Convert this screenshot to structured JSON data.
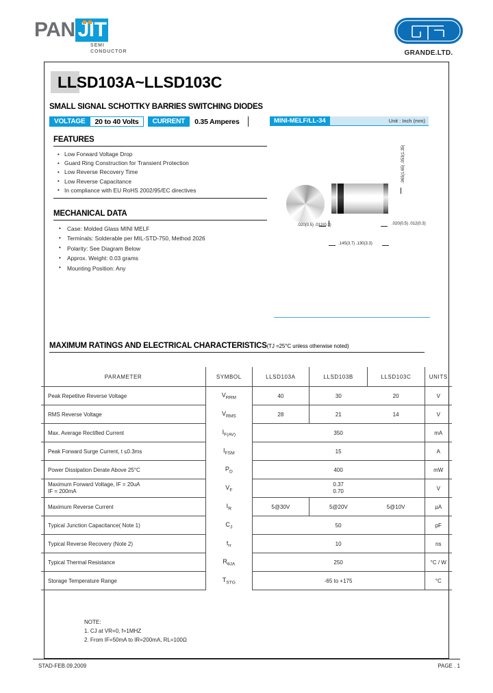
{
  "brand": {
    "panjit_pan": "PAN",
    "panjit_jit": "JIT",
    "panjit_sub_line1": "SEMI",
    "panjit_sub_line2": "CONDUCTOR",
    "grande_name": "GRANDE.LTD.",
    "accent_blue": "#0d9ddb",
    "accent_orange": "#f7941e"
  },
  "header": {
    "part_title": "LLSD103A~LLSD103C",
    "subtitle": "SMALL SIGNAL SCHOTTKY BARRIES SWITCHING DIODES"
  },
  "specbar": {
    "voltage_label": "VOLTAGE",
    "voltage_value": "20 to 40 Volts",
    "current_label": "CURRENT",
    "current_value": "0.35 Amperes",
    "package_name": "MINI-MELF/LL-34",
    "unit_note": "Unit : Inch (mm)"
  },
  "features": {
    "title": "FEATURES",
    "items": [
      "Low Forward Voltage Drop",
      "Guard Ring Construction for Transient Protection",
      "Low Reverse Recovery Time",
      "Low Reverse Capacitance",
      "In compliance with EU RoHS 2002/95/EC directives"
    ]
  },
  "mechanical": {
    "title": "MECHANICAL DATA",
    "items": [
      "Case: Molded Glass MINI MELF",
      "Terminals: Solderable per MIL-STD-750, Method 2026",
      "Polarity: See Diagram Below",
      "Approx. Weight: 0.03 grams",
      "Mounting Position: Any"
    ]
  },
  "package_drawing": {
    "dim_left": ".020(0.5)\n.012(0.3)",
    "dim_right": ".020(0.5)\n.012(0.3)",
    "dim_bottom": ".145(3.7)\n.130(3.3)",
    "dim_height": ".065(1.65)\n.053(1.35)"
  },
  "ratings": {
    "heading": "MAXIMUM RATINGS AND ELECTRICAL CHARACTERISTICS",
    "heading_note": "(TJ =25°C unless otherwise noted)",
    "columns": [
      "PARAMETER",
      "SYMBOL",
      "LLSD103A",
      "LLSD103B",
      "LLSD103C",
      "UNITS"
    ],
    "rows": [
      {
        "parameter": "Peak Repetitve Reverse Voltage",
        "symbol_main": "V",
        "symbol_sub": "RRM",
        "a": "40",
        "b": "30",
        "c": "20",
        "units": "V",
        "span": false
      },
      {
        "parameter": "RMS Reverse Voltage",
        "symbol_main": "V",
        "symbol_sub": "RMS",
        "a": "28",
        "b": "21",
        "c": "14",
        "units": "V",
        "span": false
      },
      {
        "parameter": "Max. Average Rectified Current",
        "symbol_main": "I",
        "symbol_sub": "F(AV)",
        "value": "350",
        "units": "mA",
        "span": true
      },
      {
        "parameter": "Peak Forward Surge Current, t ≤0.3ms",
        "symbol_main": "I",
        "symbol_sub": "FSM",
        "value": "15",
        "units": "A",
        "span": true
      },
      {
        "parameter": "Power Dissipation Derate Above 25°C",
        "symbol_main": "P",
        "symbol_sub": "D",
        "value": "400",
        "units": "mW",
        "span": true
      },
      {
        "parameter": "Maximum Forward Voltage, IF = 20uA\nIF = 200mA",
        "symbol_main": "V",
        "symbol_sub": "F",
        "value": "0.37\n0.70",
        "units": "V",
        "span": true
      },
      {
        "parameter": "Maximum Reverse Current",
        "symbol_main": "I",
        "symbol_sub": "R",
        "a": "5@30V",
        "b": "5@20V",
        "c": "5@10V",
        "units": "µA",
        "span": false
      },
      {
        "parameter": "Typical Junction Capacitance( Note 1)",
        "symbol_main": "C",
        "symbol_sub": "J",
        "value": "50",
        "units": "pF",
        "span": true
      },
      {
        "parameter": "Typical Reverse Recovery (Note 2)",
        "symbol_main": "t",
        "symbol_sub": "rr",
        "value": "10",
        "units": "ns",
        "span": true
      },
      {
        "parameter": "Typical Thermal Resistance",
        "symbol_main": "R",
        "symbol_sub": "θJA",
        "value": "250",
        "units": "°C / W",
        "span": true
      },
      {
        "parameter": "Storage Temperature Range",
        "symbol_main": "T",
        "symbol_sub": "STG",
        "value": "-65 to +175",
        "units": "°C",
        "span": true
      }
    ]
  },
  "notes": {
    "title": "NOTE:",
    "items": [
      "1. CJ at VR=0, f=1MHZ",
      "2. From IF=50mA to IR=200mA, RL=100Ω"
    ]
  },
  "footer": {
    "left": "STAD-FEB.09.2009",
    "right": "PAGE . 1"
  }
}
